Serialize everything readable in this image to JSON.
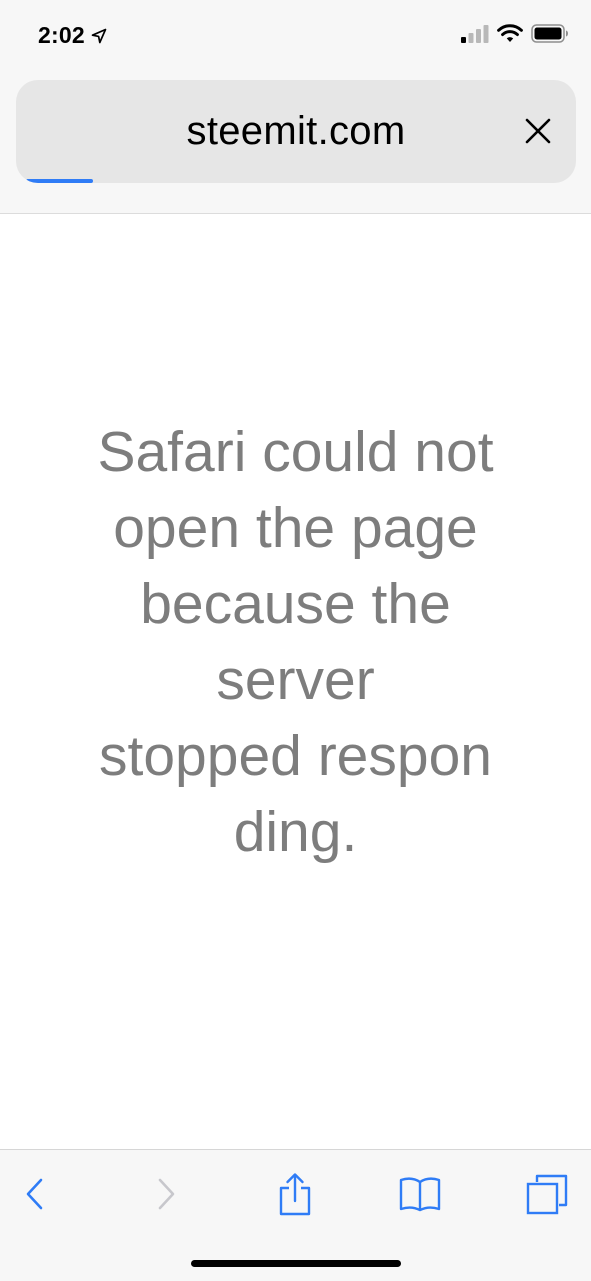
{
  "status_bar": {
    "time": "2:02",
    "location_icon": "location-arrow-icon",
    "signal_icon": "cellular-signal-icon",
    "wifi_icon": "wifi-icon",
    "battery_icon": "battery-icon"
  },
  "address_bar": {
    "url": "steemit.com",
    "clear_icon": "close-icon",
    "load_progress": 0.12
  },
  "error": {
    "lines": [
      "Safari could not",
      "open the page",
      "because the",
      "server",
      "stopped respon",
      "ding."
    ]
  },
  "toolbar": {
    "back_icon": "chevron-left-icon",
    "forward_icon": "chevron-right-icon",
    "share_icon": "share-icon",
    "bookmarks_icon": "book-icon",
    "tabs_icon": "tabs-icon"
  },
  "colors": {
    "accent": "#2f7cf6",
    "error_text": "#7d7d7d",
    "disabled": "#c7c7cc"
  }
}
